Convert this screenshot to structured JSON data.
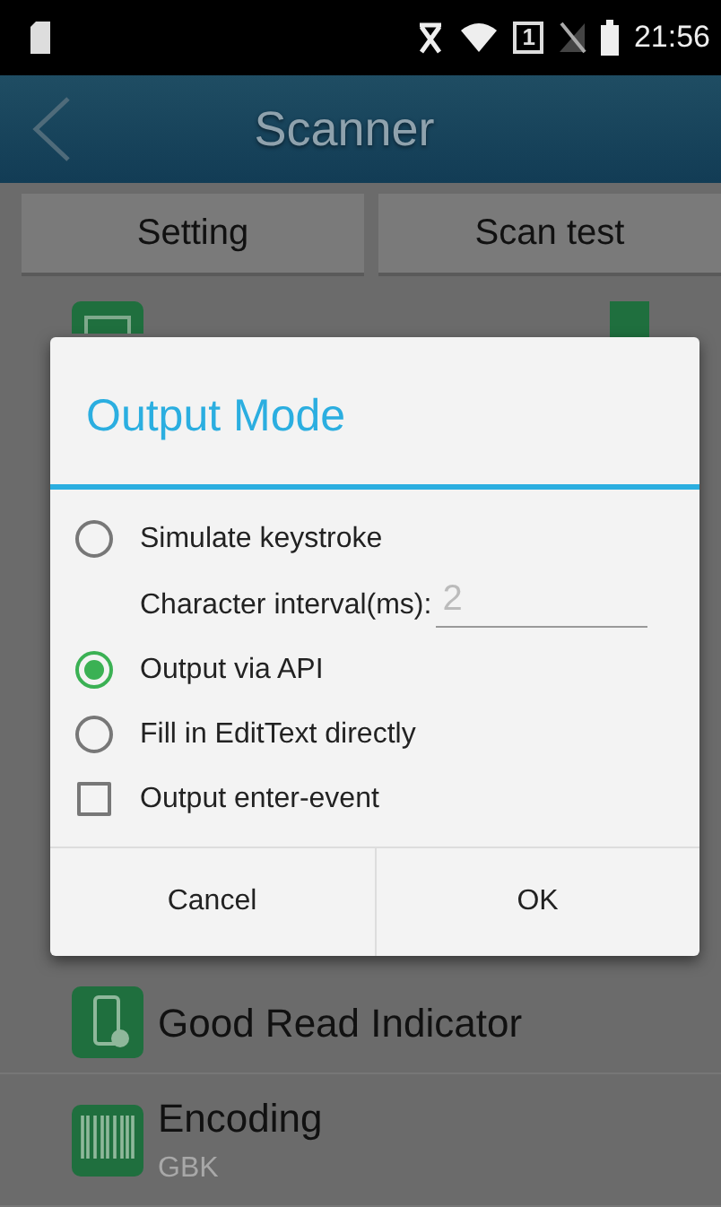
{
  "status_bar": {
    "sim_number": "1",
    "time": "21:56"
  },
  "app_bar": {
    "title": "Scanner"
  },
  "tabs": [
    {
      "label": "Setting",
      "selected": false
    },
    {
      "label": "Scan test",
      "selected": false
    }
  ],
  "list": [
    {
      "checked": true
    },
    {
      "title": "Good Read Indicator"
    },
    {
      "title": "Encoding",
      "subtitle": "GBK"
    }
  ],
  "dialog": {
    "title": "Output Mode",
    "options": [
      {
        "kind": "radio",
        "label": "Simulate keystroke",
        "selected": false,
        "field": {
          "label": "Character interval(ms):",
          "placeholder": "2"
        }
      },
      {
        "kind": "radio",
        "label": "Output via API",
        "selected": true
      },
      {
        "kind": "radio",
        "label": "Fill in EditText directly",
        "selected": false
      },
      {
        "kind": "checkbox",
        "label": "Output enter-event",
        "checked": false
      }
    ],
    "buttons": [
      "Cancel",
      "OK"
    ]
  }
}
